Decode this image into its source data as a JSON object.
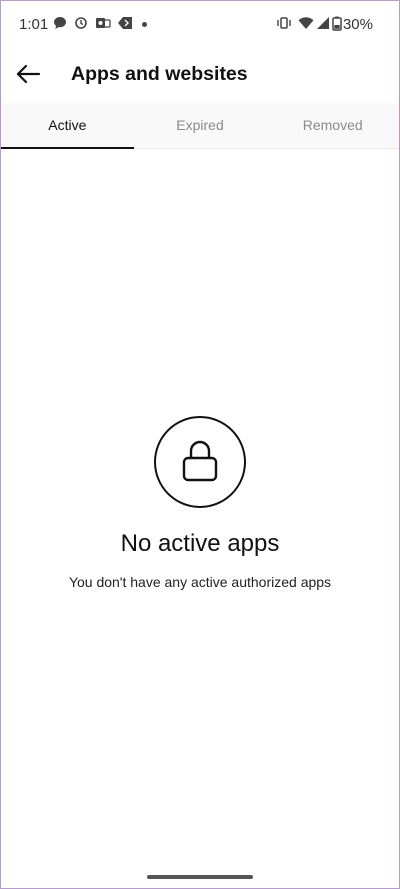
{
  "status_bar": {
    "time": "1:01",
    "battery_percent": "30%",
    "icons": [
      "chat-bubble-icon",
      "history-icon",
      "outlook-icon",
      "arrow-left-fill-icon",
      "notification-dot-icon",
      "vibrate-icon",
      "wifi-icon",
      "signal-icon",
      "battery-icon"
    ]
  },
  "header": {
    "title": "Apps and websites",
    "back_icon": "arrow-left-icon"
  },
  "tabs": [
    {
      "label": "Active",
      "active": true
    },
    {
      "label": "Expired",
      "active": false
    },
    {
      "label": "Removed",
      "active": false
    }
  ],
  "empty_state": {
    "icon": "lock-icon",
    "title": "No active apps",
    "subtitle": "You don't have any active authorized apps"
  }
}
